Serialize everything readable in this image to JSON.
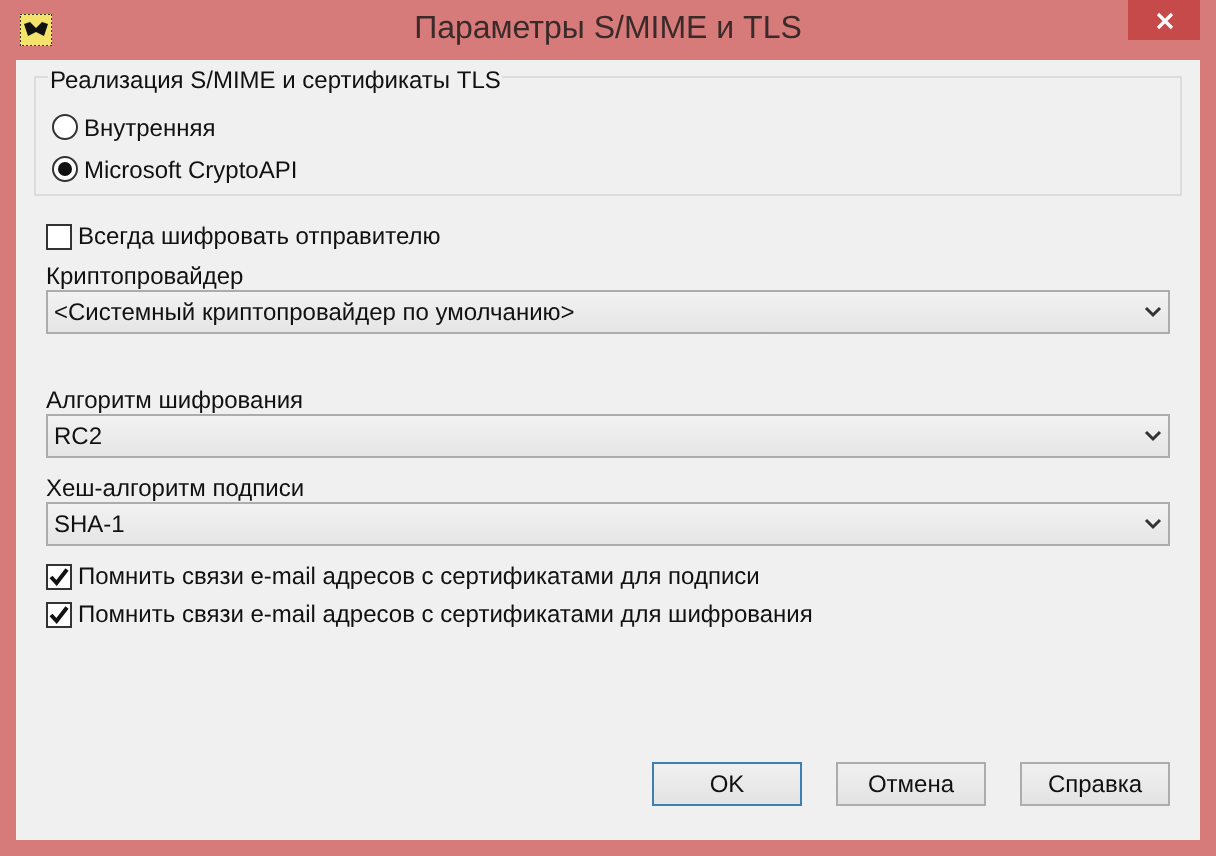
{
  "window": {
    "title": "Параметры S/MIME и TLS"
  },
  "implementation": {
    "title": "Реализация S/MIME и сертификаты TLS",
    "options": [
      {
        "label": "Внутренняя",
        "selected": false
      },
      {
        "label": "Microsoft CryptoAPI",
        "selected": true
      }
    ]
  },
  "always_encrypt": {
    "label": "Всегда шифровать отправителю",
    "checked": false
  },
  "fields": [
    {
      "label": "Криптопровайдер",
      "value": "<Системный криптопровайдер по умолчанию>"
    },
    {
      "label": "Алгоритм шифрования",
      "value": "RC2"
    },
    {
      "label": "Хеш-алгоритм подписи",
      "value": "SHA-1"
    }
  ],
  "remember": [
    {
      "label": "Помнить связи e-mail адресов с сертификатами для подписи",
      "checked": true
    },
    {
      "label": "Помнить связи e-mail адресов с сертификатами для шифрования",
      "checked": true
    }
  ],
  "buttons": [
    {
      "label": "OK",
      "default": true
    },
    {
      "label": "Отмена",
      "default": false
    },
    {
      "label": "Справка",
      "default": false
    }
  ]
}
